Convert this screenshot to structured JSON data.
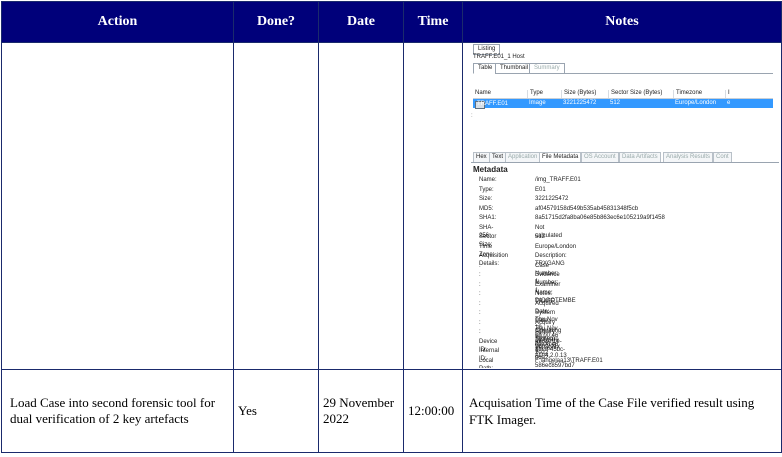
{
  "headers": {
    "action": "Action",
    "done": "Done?",
    "date": "Date",
    "time": "Time",
    "notes": "Notes"
  },
  "rows": [
    {
      "action": "",
      "done": "",
      "date": "",
      "time": "",
      "screenshot": {
        "listing_label": "Listing",
        "path_label": "TRAFF.E01_1 Host",
        "top_tabs": [
          "Table",
          "Thumbnail",
          "Summary"
        ],
        "columns": [
          "Name",
          "Type",
          "Size (Bytes)",
          "Sector Size (Bytes)",
          "Timezone",
          "I"
        ],
        "selected_row": {
          "name": "TRAFF.E01",
          "type": "Image",
          "size": "3221225472",
          "sector_size": "512",
          "timezone": "Europe/London",
          "extra": "e"
        },
        "bottom_tabs": [
          "Hex",
          "Text",
          "Application",
          "File Metadata",
          "OS Account",
          "Data Artifacts",
          "Analysis Results",
          "Cont"
        ],
        "metadata_title": "Metadata",
        "metadata": [
          {
            "key": "Name:",
            "value": "/img_TRAFF.E01"
          },
          {
            "key": "Type:",
            "value": "E01"
          },
          {
            "key": "Size:",
            "value": "3221225472"
          },
          {
            "key": "MD5:",
            "value": "af04579158d549b535ab45831348f5cb"
          },
          {
            "key": "SHA1:",
            "value": "8a51715d2fa8ba06e85b863ec6e105219a9f1458"
          },
          {
            "key": "SHA-256:",
            "value": "Not calculated"
          },
          {
            "key": "Sector Size:",
            "value": "512"
          },
          {
            "key": "Time Zone:",
            "value": "Europe/London"
          },
          {
            "key": "Acquisition Details:",
            "value": "Description: TRXGANG"
          },
          {
            "key": ":",
            "value": "Case Number: 1"
          },
          {
            "key": ":",
            "value": "Evidence Number: 1"
          },
          {
            "key": ":",
            "value": "Examiner Name: DIOGOTEMBE"
          },
          {
            "key": ":",
            "value": "Notes: TRAFF"
          },
          {
            "key": ":",
            "value": "Acquired Date: Thu Nov 10 09:00:46 2022"
          },
          {
            "key": ":",
            "value": "System Date: Thu Nov 10 09:00:46 2022"
          },
          {
            "key": ":",
            "value": "Acquiry Operating System: Win 201x"
          },
          {
            "key": ":",
            "value": "Acquiry Software Version: ADI4.2.0.13"
          },
          {
            "key": "Device ID:",
            "value": "e5c1ef1e-8dc0-45bc-bda2-586ec8597bd7"
          },
          {
            "key": "Internal ID:",
            "value": "1"
          },
          {
            "key": "Local Path:",
            "value": "F:\\angelaa13\\TRAFF.E01"
          }
        ]
      }
    },
    {
      "action": "Load Case into second forensic tool for dual verification of 2 key artefacts",
      "done": "Yes",
      "date": "29 November 2022",
      "time": "12:00:00",
      "notes": "Acquisation Time of the Case File verified result using FTK Imager."
    }
  ]
}
